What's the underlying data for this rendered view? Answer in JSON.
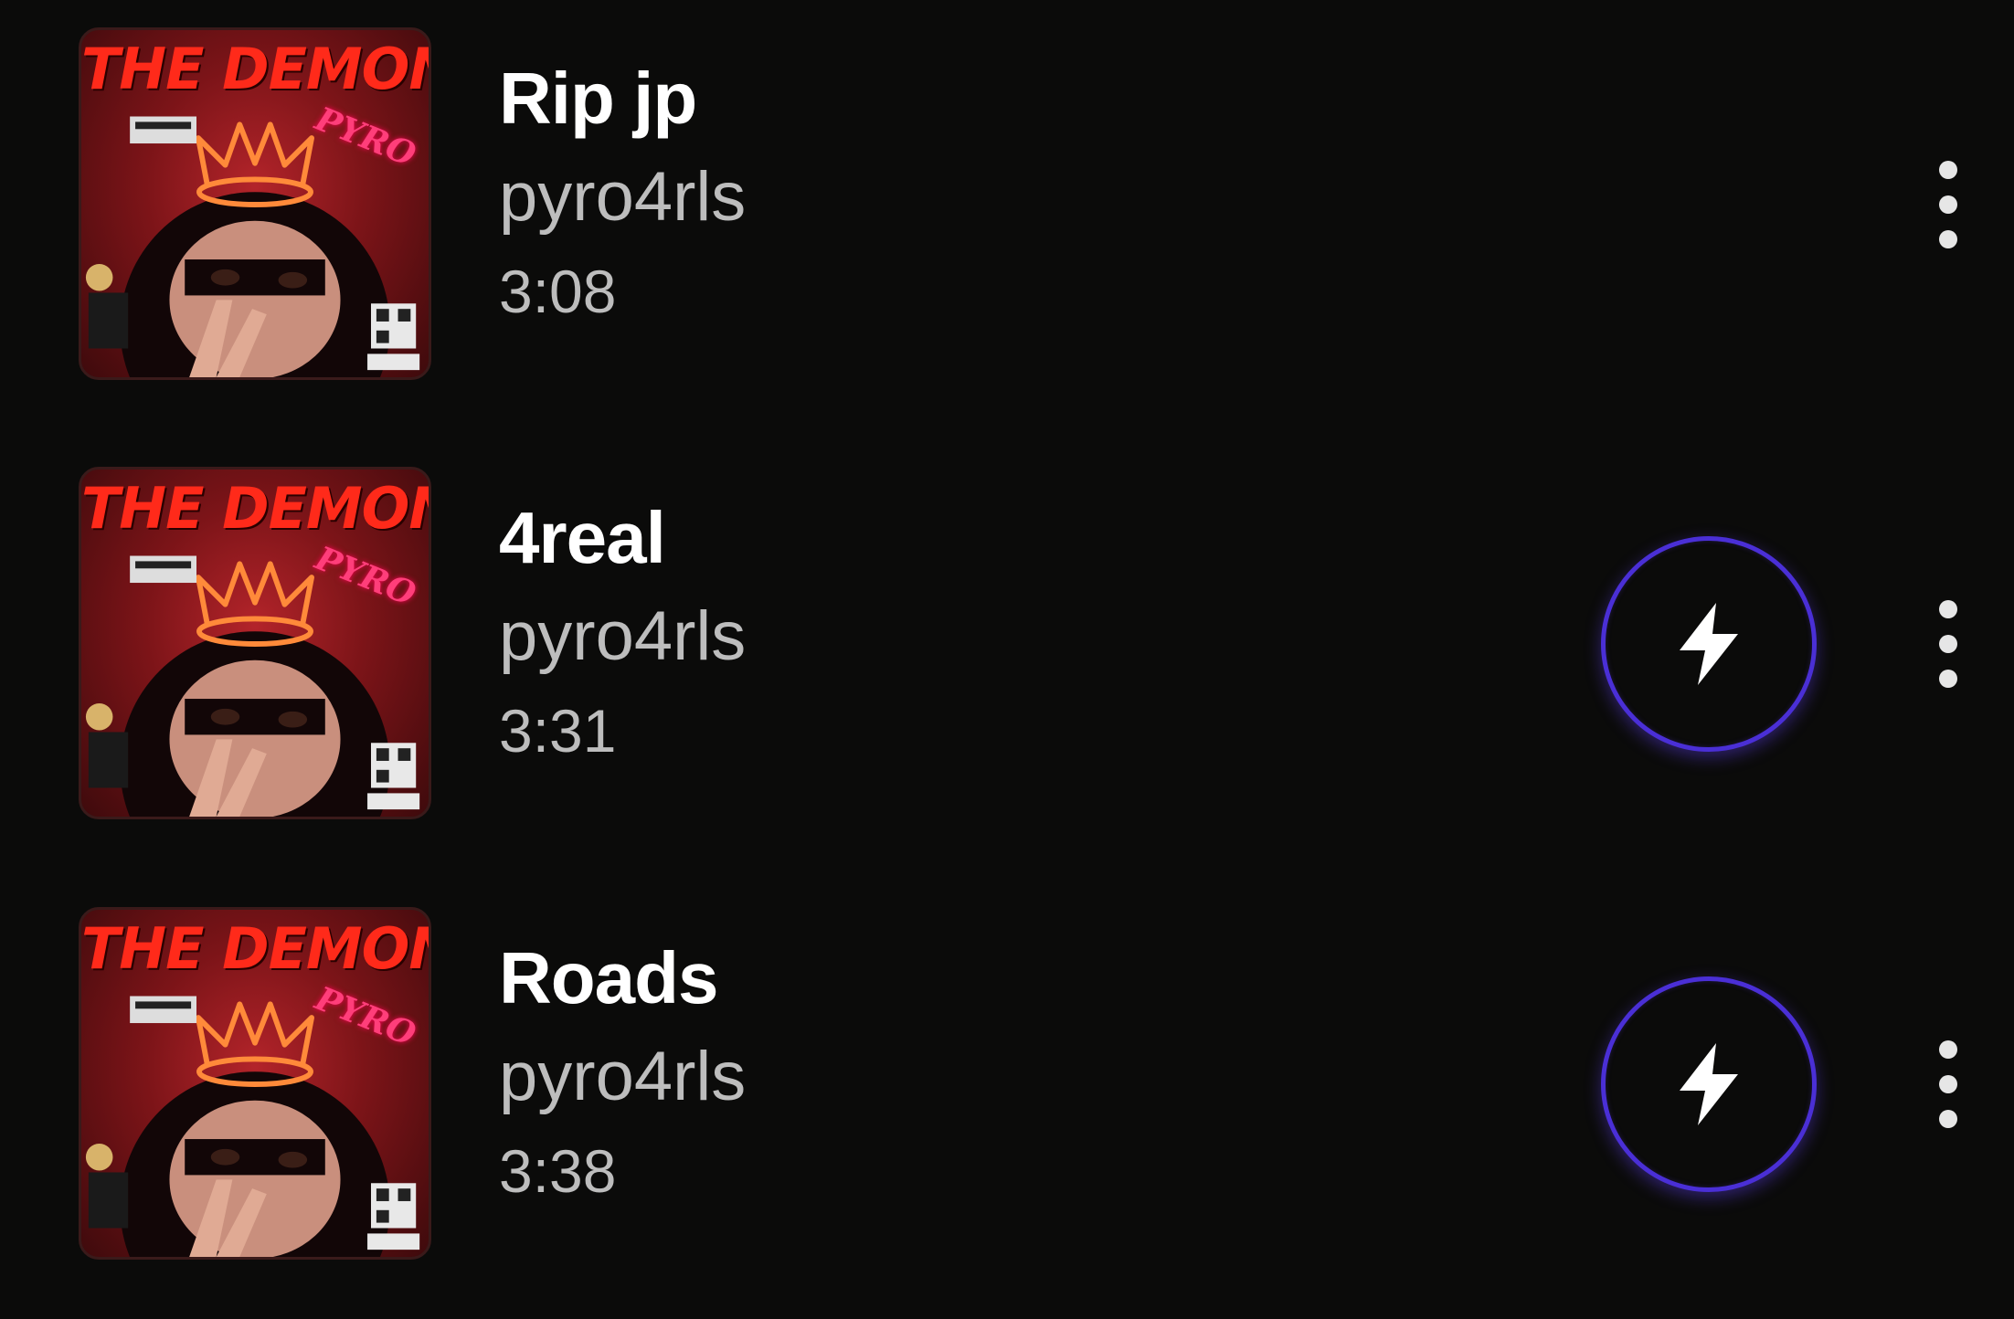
{
  "album_art": {
    "title": "THE DEMON",
    "artist_tag": "PYRO"
  },
  "colors": {
    "background": "#0b0b0a",
    "boost_ring": "#4a2fd6",
    "title_text": "#ffffff",
    "secondary_text": "#bdbdbd"
  },
  "tracks": [
    {
      "title": "Rip jp",
      "artist": "pyro4rls",
      "duration": "3:08",
      "boost_visible": false,
      "boost_icon": "lightning-bolt-icon",
      "more_icon": "more-vertical-icon"
    },
    {
      "title": "4real",
      "artist": "pyro4rls",
      "duration": "3:31",
      "boost_visible": true,
      "boost_icon": "lightning-bolt-icon",
      "more_icon": "more-vertical-icon"
    },
    {
      "title": "Roads",
      "artist": "pyro4rls",
      "duration": "3:38",
      "boost_visible": true,
      "boost_icon": "lightning-bolt-icon",
      "more_icon": "more-vertical-icon"
    }
  ]
}
